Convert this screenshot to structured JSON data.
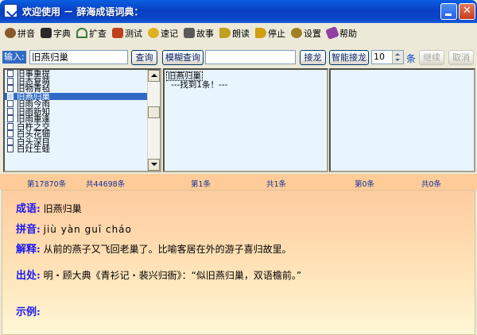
{
  "window": {
    "title": "欢迎使用 － 辞海成语词典："
  },
  "toolbar": {
    "items": [
      {
        "label": "拼音",
        "color": "#8a5a2a"
      },
      {
        "label": "字典",
        "color": "#2a2a2a"
      },
      {
        "label": "扩查",
        "color": "#3a7a3a"
      },
      {
        "label": "测试",
        "color": "#c04020"
      },
      {
        "label": "速记",
        "color": "#e0b020"
      },
      {
        "label": "故事",
        "color": "#5a5a5a"
      },
      {
        "label": "朗读",
        "color": "#c0a020"
      },
      {
        "label": "停止",
        "color": "#d0a010"
      },
      {
        "label": "设置",
        "color": "#a08020"
      },
      {
        "label": "帮助",
        "color": "#9040a0"
      }
    ]
  },
  "search": {
    "label": "输入:",
    "value": "旧燕归巢",
    "query_button": "查询",
    "fuzzy_button": "模糊查询",
    "solitaire_button": "接龙",
    "smart_solitaire_button": "智能接龙",
    "count": "10",
    "count_unit": "条",
    "continue_button": "继续",
    "cancel_button": "取消"
  },
  "idiom_list": {
    "items": [
      "旧事重提",
      "旧态复萌",
      "旧物青毡",
      "旧燕归巢",
      "旧雨今雨",
      "旧雨新知",
      "旧雨重逢",
      "白杵之交",
      "白头花钿",
      "白头深目",
      "白灶生蛙"
    ],
    "selected_index": 3
  },
  "results": {
    "selected": "旧燕归巢",
    "found": "---找到1条！---"
  },
  "status": {
    "current": "第17870条",
    "total": "共44698条",
    "result_current": "第1条",
    "result_total": "共1条",
    "extra_current": "第0条",
    "extra_total": "共0条"
  },
  "detail": {
    "idiom_label": "成语:",
    "idiom": "旧燕归巢",
    "pinyin_label": "拼音:",
    "pinyin": "jiù  yàn  guī  cháo",
    "meaning_label": "解释:",
    "meaning": "从前的燕子又飞回老巢了。比喻客居在外的游子喜归故里。",
    "source_label": "出处:",
    "source": "明・顾大典《青衫记・裴兴归衙》：“似旧燕归巢，双语檐前。”",
    "example_label": "示例:",
    "example": ""
  }
}
